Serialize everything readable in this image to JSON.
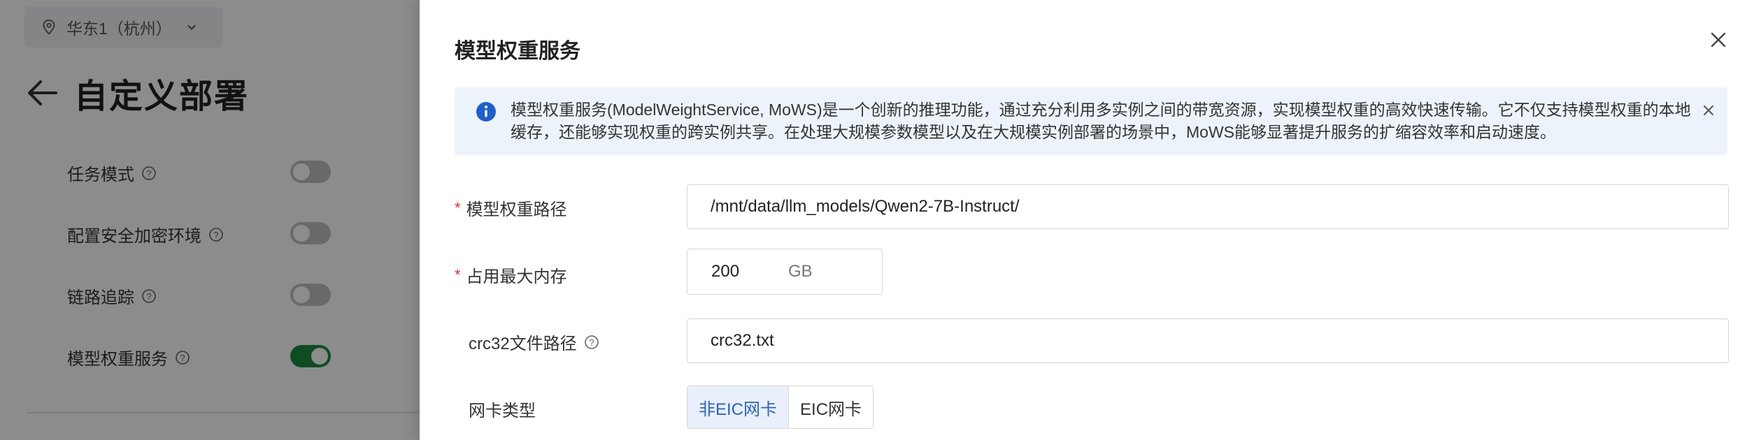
{
  "background": {
    "region": "华东1（杭州）",
    "page_title": "自定义部署",
    "options": [
      {
        "label": "任务模式",
        "enabled": false
      },
      {
        "label": "配置安全加密环境",
        "enabled": false
      },
      {
        "label": "链路追踪",
        "enabled": false
      },
      {
        "label": "模型权重服务",
        "enabled": true
      }
    ]
  },
  "drawer": {
    "title": "模型权重服务",
    "info_text": "模型权重服务(ModelWeightService, MoWS)是一个创新的推理功能，通过充分利用多实例之间的带宽资源，实现模型权重的高效快速传输。它不仅支持模型权重的本地缓存，还能够实现权重的跨实例共享。在处理大规模参数模型以及在大规模实例部署的场景中，MoWS能够显著提升服务的扩缩容效率和启动速度。",
    "fields": {
      "weight_path": {
        "label": "模型权重路径",
        "required": "*",
        "value": "/mnt/data/llm_models/Qwen2-7B-Instruct/"
      },
      "max_memory": {
        "label": "占用最大内存",
        "required": "*",
        "value": "200",
        "unit": "GB"
      },
      "crc32_path": {
        "label": "crc32文件路径",
        "value": "crc32.txt"
      },
      "nic_type": {
        "label": "网卡类型",
        "options": [
          "非EIC网卡",
          "EIC网卡"
        ],
        "selected": "非EIC网卡"
      }
    }
  },
  "colors": {
    "accent": "#2a63c6",
    "switch_on": "#1a8a3c",
    "info_bg": "#edf3fb",
    "required": "#e0312e"
  }
}
